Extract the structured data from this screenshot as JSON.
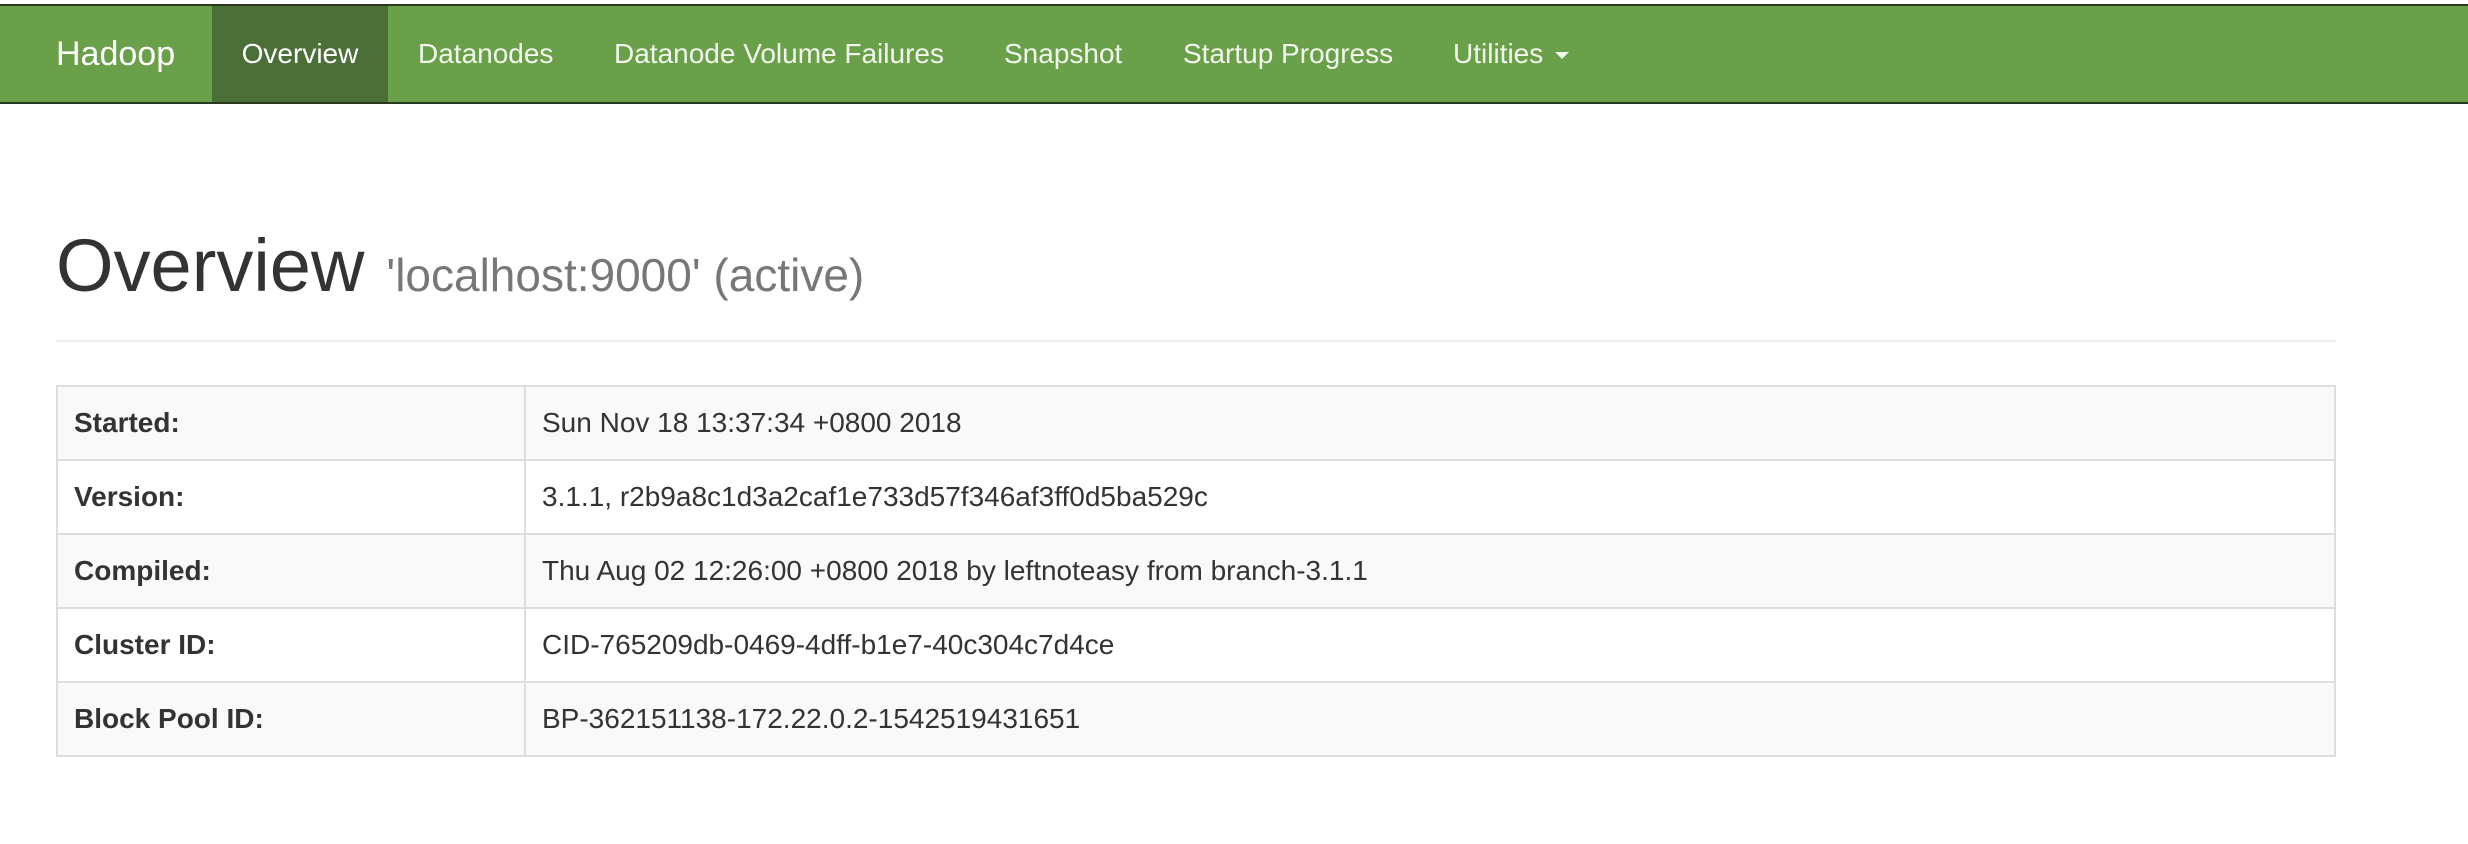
{
  "navbar": {
    "brand": "Hadoop",
    "items": [
      {
        "label": "Overview",
        "active": true
      },
      {
        "label": "Datanodes"
      },
      {
        "label": "Datanode Volume Failures"
      },
      {
        "label": "Snapshot"
      },
      {
        "label": "Startup Progress"
      },
      {
        "label": "Utilities",
        "dropdown": true
      }
    ],
    "accent_color": "#6ba04a",
    "active_color": "#4c6e37"
  },
  "header": {
    "title": "Overview",
    "subtitle": "'localhost:9000' (active)"
  },
  "info_table": {
    "rows": [
      {
        "key": "Started:",
        "value": "Sun Nov 18 13:37:34 +0800 2018"
      },
      {
        "key": "Version:",
        "value": "3.1.1, r2b9a8c1d3a2caf1e733d57f346af3ff0d5ba529c"
      },
      {
        "key": "Compiled:",
        "value": "Thu Aug 02 12:26:00 +0800 2018 by leftnoteasy from branch-3.1.1"
      },
      {
        "key": "Cluster ID:",
        "value": "CID-765209db-0469-4dff-b1e7-40c304c7d4ce"
      },
      {
        "key": "Block Pool ID:",
        "value": "BP-362151138-172.22.0.2-1542519431651"
      }
    ]
  }
}
